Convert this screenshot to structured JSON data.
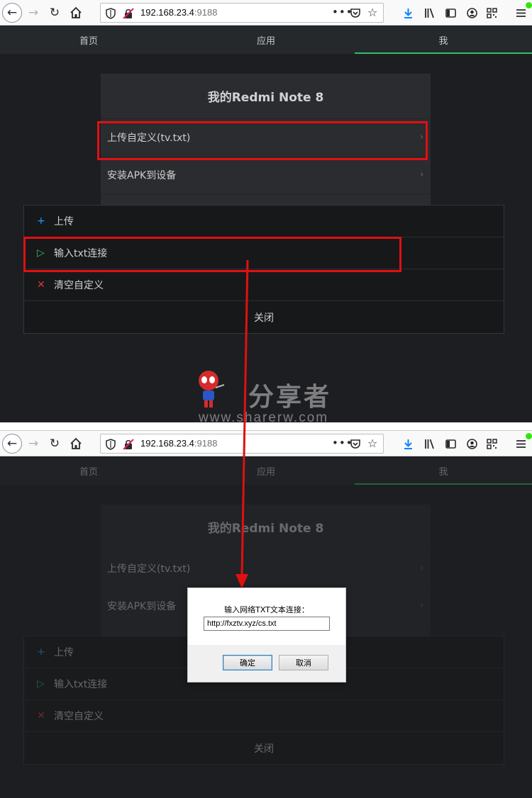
{
  "browser": {
    "url_host": "192.168.23.4",
    "url_port": ":9188"
  },
  "tabs": [
    "首页",
    "应用",
    "我"
  ],
  "device": {
    "title": "我的Redmi Note 8",
    "rows": [
      "上传自定义(tv.txt)",
      "安装APK到设备"
    ]
  },
  "sheet": {
    "items": [
      {
        "label": "上传",
        "icon": "+"
      },
      {
        "label": "输入txt连接",
        "icon": "▷"
      },
      {
        "label": "清空自定义",
        "icon": "✕"
      }
    ],
    "close_label": "关闭"
  },
  "watermark": {
    "cn": "分享者",
    "en": "www.sharerw.com"
  },
  "dialog": {
    "prompt": "输入网络TXT文本连接：",
    "input_value": "http://fxztv.xyz/cs.txt",
    "ok_label": "确定",
    "cancel_label": "取消"
  },
  "colors": {
    "highlight": "#e01010",
    "tab_active": "#2fbe6b",
    "plus_icon": "#1e9fff",
    "play_icon": "#2fbe6b",
    "x_icon": "#e0332e"
  }
}
